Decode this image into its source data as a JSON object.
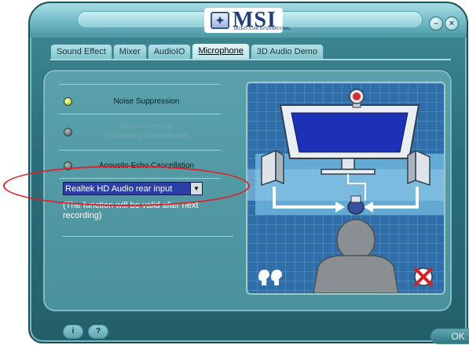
{
  "window": {
    "brand": "MSI",
    "brand_tagline": "MICRO-STAR INTERNATIONAL",
    "minimize_symbol": "–",
    "close_symbol": "×"
  },
  "tabs": [
    {
      "label": "Sound Effect",
      "active": false
    },
    {
      "label": "Mixer",
      "active": false
    },
    {
      "label": "AudioIO",
      "active": false
    },
    {
      "label": "Microphone",
      "active": true
    },
    {
      "label": "3D Audio Demo",
      "active": false
    }
  ],
  "options": [
    {
      "label": "Noise Suppression",
      "led": "on",
      "enabled": true
    },
    {
      "label": "Beam Forming (Stationary Microphone)",
      "label_line1": "Beam Forming",
      "label_line2": "(Stationary Microphone)",
      "led": "off",
      "enabled": false
    },
    {
      "label": "Acoustic Echo Cancellation",
      "led": "off",
      "enabled": true
    }
  ],
  "input_select": {
    "value": "Realtek HD Audio rear input",
    "arrow": "▼"
  },
  "note": "(The function will be valid after next recording)",
  "bottom": {
    "info_icon": "i",
    "help_icon": "?",
    "ok_label": "OK"
  },
  "colors": {
    "accent": "#2b3fa8",
    "highlight": "#e01f26",
    "scene_bg": "#2f6ea8"
  }
}
